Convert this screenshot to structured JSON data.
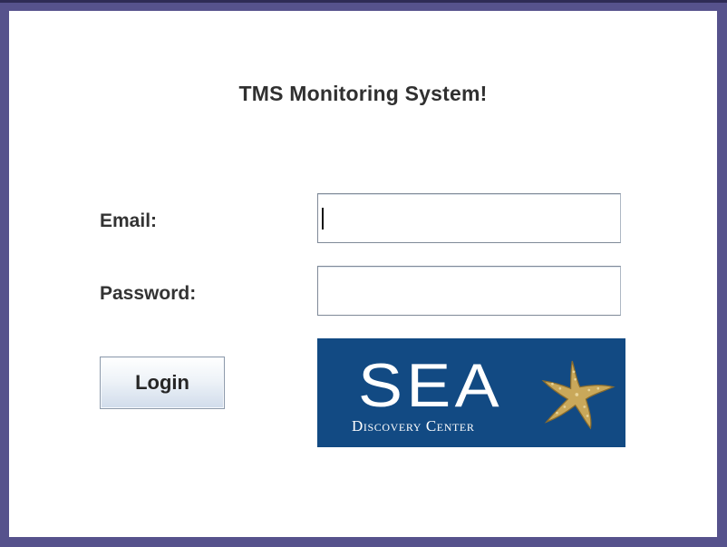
{
  "window": {
    "title": "TMS Monitoring System!"
  },
  "form": {
    "email_label": "Email:",
    "email_value": "",
    "password_label": "Password:",
    "password_value": "",
    "login_label": "Login"
  },
  "logo": {
    "main_text": "SEA",
    "sub_text": "Discovery Center",
    "icon": "starfish-icon"
  },
  "colors": {
    "frame": "#56528c",
    "panel": "#ffffff",
    "logo_background": "#124a83",
    "starfish": "#c9a85a"
  }
}
